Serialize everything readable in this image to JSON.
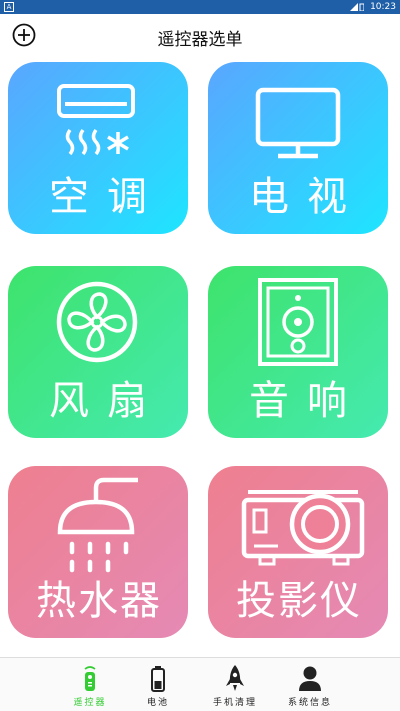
{
  "status": {
    "time": "10:23",
    "notification_icon": "A"
  },
  "header": {
    "title": "遥控器选单",
    "add_icon": "plus-circle-icon"
  },
  "tiles": [
    {
      "label": "空调",
      "icon": "air-conditioner-icon",
      "gradient": [
        "#5aa6ff",
        "#1ee5ff"
      ]
    },
    {
      "label": "电视",
      "icon": "tv-icon",
      "gradient": [
        "#5aa6ff",
        "#1ee5ff"
      ]
    },
    {
      "label": "风扇",
      "icon": "fan-icon",
      "gradient": [
        "#3ee36b",
        "#45eab0"
      ]
    },
    {
      "label": "音响",
      "icon": "speaker-icon",
      "gradient": [
        "#3ee36b",
        "#45eab0"
      ]
    },
    {
      "label": "热水器",
      "icon": "shower-icon",
      "gradient": [
        "#ee7f8f",
        "#e58ab5"
      ]
    },
    {
      "label": "投影仪",
      "icon": "projector-icon",
      "gradient": [
        "#ee7f8f",
        "#e58ab5"
      ]
    }
  ],
  "tabs": [
    {
      "label": "遥控器",
      "icon": "remote-icon",
      "active": true
    },
    {
      "label": "电池",
      "icon": "battery-icon",
      "active": false
    },
    {
      "label": "手机清理",
      "icon": "rocket-icon",
      "active": false
    },
    {
      "label": "系统信息",
      "icon": "user-icon",
      "active": false
    }
  ],
  "colors": {
    "active_tab": "#33cc33",
    "status_bar": "#1f5fa8"
  }
}
